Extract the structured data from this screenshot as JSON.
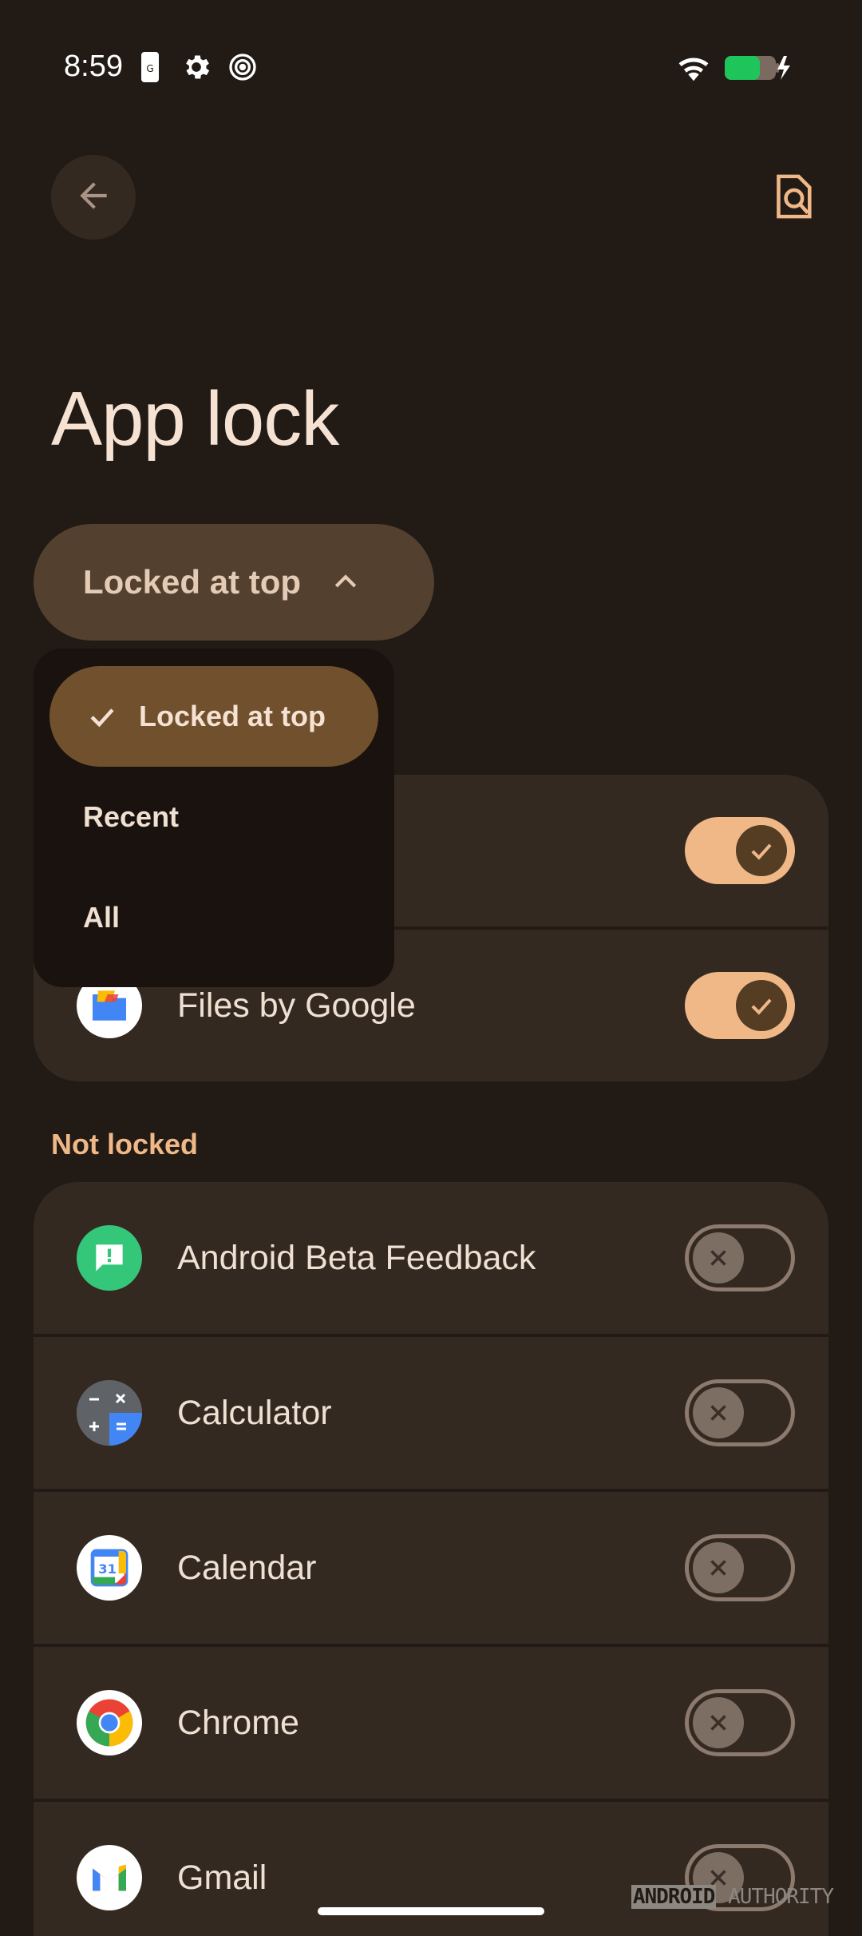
{
  "status_bar": {
    "time": "8:59",
    "icons": [
      "sim-icon",
      "gear-icon",
      "hotspot-icon",
      "wifi-icon",
      "battery-charging-icon"
    ],
    "battery_color": "#1ec55a"
  },
  "top_bar": {
    "back_icon": "arrow-back-icon",
    "action_icon": "document-search-icon"
  },
  "page": {
    "title": "App lock"
  },
  "sort": {
    "label": "Locked at top",
    "chevron_icon": "chevron-up-icon"
  },
  "menu": {
    "items": [
      {
        "label": "Locked at top",
        "selected": true
      },
      {
        "label": "Recent",
        "selected": false
      },
      {
        "label": "All",
        "selected": false
      }
    ]
  },
  "locked_apps": [
    {
      "name": "",
      "icon": "app-icon",
      "locked": true
    },
    {
      "name": "Files by Google",
      "icon": "files-icon",
      "locked": true
    }
  ],
  "not_locked": {
    "header": "Not locked",
    "apps": [
      {
        "name": "Android Beta Feedback",
        "icon": "feedback-icon",
        "locked": false
      },
      {
        "name": "Calculator",
        "icon": "calculator-icon",
        "locked": false
      },
      {
        "name": "Calendar",
        "icon": "calendar-icon",
        "locked": false
      },
      {
        "name": "Chrome",
        "icon": "chrome-icon",
        "locked": false
      },
      {
        "name": "Gmail",
        "icon": "gmail-icon",
        "locked": false
      }
    ]
  },
  "calendar_day": "31",
  "watermark": {
    "part1": "ANDROID",
    "part2": "AUTHORITY"
  },
  "colors": {
    "background": "#211a15",
    "card": "#342921",
    "accent": "#f0b887",
    "chip": "#54402e",
    "menu_selected": "#71502e"
  }
}
